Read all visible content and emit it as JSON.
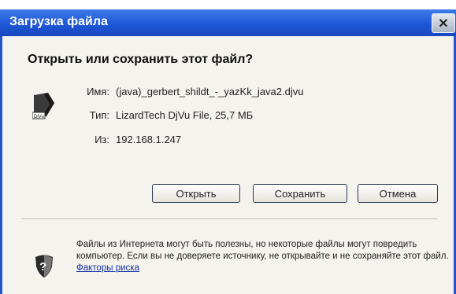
{
  "dialog": {
    "title": "Загрузка файла",
    "close_glyph": "✕",
    "question": "Открыть или сохранить этот файл?",
    "file": {
      "name_label": "Имя:",
      "name_value": "(java)_gerbert_shildt_-_yazKk_java2.djvu",
      "type_label": "Тип:",
      "type_value": "LizardTech DjVu File, 25,7 МБ",
      "from_label": "Из:",
      "from_value": "192.168.1.247",
      "icon": "djvu-file-icon"
    },
    "buttons": {
      "open": "Открыть",
      "save": "Сохранить",
      "cancel": "Отмена"
    },
    "warning": {
      "text": "Файлы из Интернета могут быть полезны, но некоторые файлы могут повредить компьютер. Если вы не доверяете источнику, не открывайте и не сохраняйте этот файл. ",
      "link": "Факторы риска",
      "icon": "shield-warning-icon"
    }
  },
  "colors": {
    "titlebar": "#1f57d6",
    "dialog_bg": "#f4f3ee",
    "link": "#1230a8"
  }
}
